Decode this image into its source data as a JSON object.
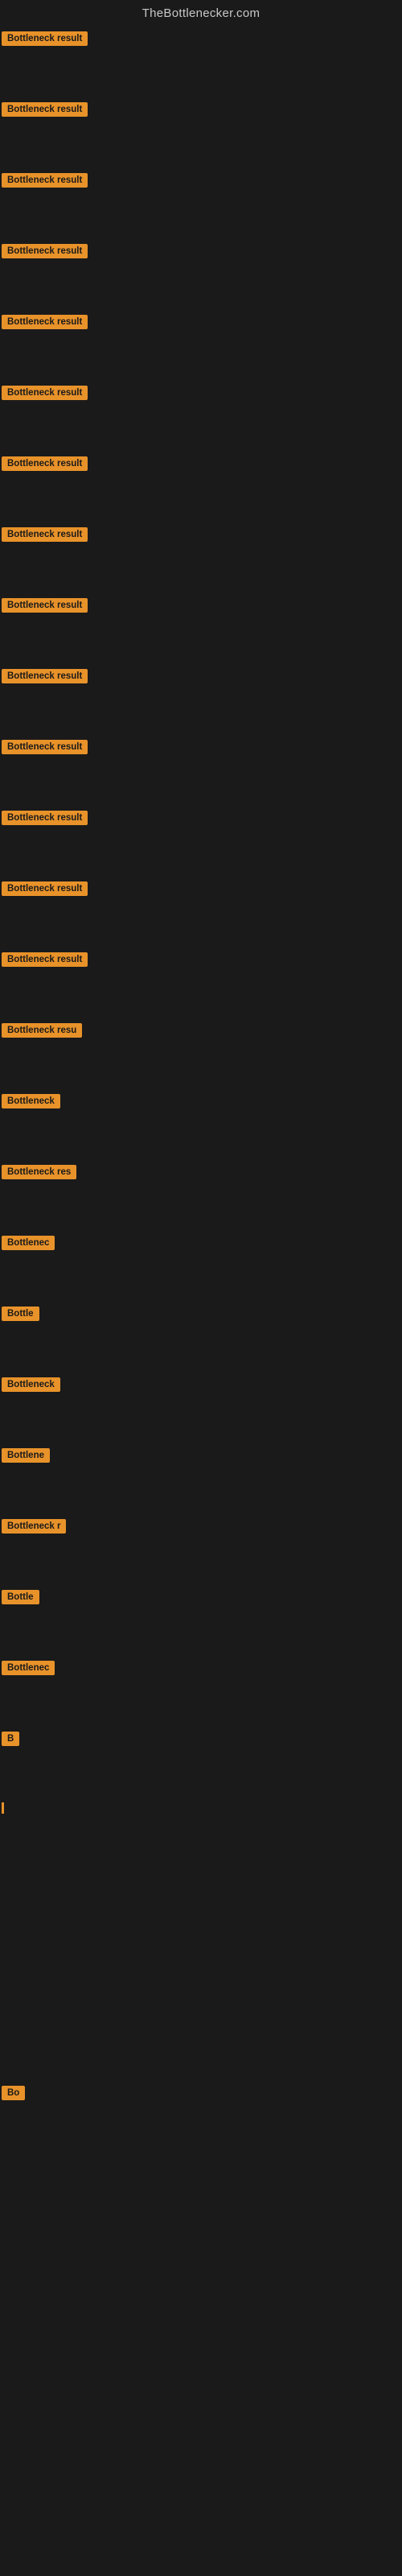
{
  "header": {
    "title": "TheBottlenecker.com"
  },
  "rows": [
    {
      "id": 1,
      "label": "Bottleneck result",
      "label_width": 120
    },
    {
      "id": 2,
      "label": "Bottleneck result",
      "label_width": 120
    },
    {
      "id": 3,
      "label": "Bottleneck result",
      "label_width": 120
    },
    {
      "id": 4,
      "label": "Bottleneck result",
      "label_width": 120
    },
    {
      "id": 5,
      "label": "Bottleneck result",
      "label_width": 120
    },
    {
      "id": 6,
      "label": "Bottleneck result",
      "label_width": 120
    },
    {
      "id": 7,
      "label": "Bottleneck result",
      "label_width": 120
    },
    {
      "id": 8,
      "label": "Bottleneck result",
      "label_width": 120
    },
    {
      "id": 9,
      "label": "Bottleneck result",
      "label_width": 120
    },
    {
      "id": 10,
      "label": "Bottleneck result",
      "label_width": 120
    },
    {
      "id": 11,
      "label": "Bottleneck result",
      "label_width": 120
    },
    {
      "id": 12,
      "label": "Bottleneck result",
      "label_width": 120
    },
    {
      "id": 13,
      "label": "Bottleneck result",
      "label_width": 120
    },
    {
      "id": 14,
      "label": "Bottleneck result",
      "label_width": 120
    },
    {
      "id": 15,
      "label": "Bottleneck resu",
      "label_width": 106
    },
    {
      "id": 16,
      "label": "Bottleneck",
      "label_width": 74
    },
    {
      "id": 17,
      "label": "Bottleneck res",
      "label_width": 98
    },
    {
      "id": 18,
      "label": "Bottlenec",
      "label_width": 68
    },
    {
      "id": 19,
      "label": "Bottle",
      "label_width": 50
    },
    {
      "id": 20,
      "label": "Bottleneck",
      "label_width": 68
    },
    {
      "id": 21,
      "label": "Bottlene",
      "label_width": 58
    },
    {
      "id": 22,
      "label": "Bottleneck r",
      "label_width": 78
    },
    {
      "id": 23,
      "label": "Bottle",
      "label_width": 46
    },
    {
      "id": 24,
      "label": "Bottlenec",
      "label_width": 64
    },
    {
      "id": 25,
      "label": "B",
      "label_width": 18
    },
    {
      "id": 26,
      "label": "",
      "label_width": 0
    },
    {
      "id": 27,
      "label": "",
      "label_width": 0
    },
    {
      "id": 28,
      "label": "",
      "label_width": 0
    },
    {
      "id": 29,
      "label": "",
      "label_width": 0
    },
    {
      "id": 30,
      "label": "Bo",
      "label_width": 22
    },
    {
      "id": 31,
      "label": "",
      "label_width": 0
    },
    {
      "id": 32,
      "label": "",
      "label_width": 0
    },
    {
      "id": 33,
      "label": "",
      "label_width": 0
    },
    {
      "id": 34,
      "label": "",
      "label_width": 0
    },
    {
      "id": 35,
      "label": "",
      "label_width": 0
    },
    {
      "id": 36,
      "label": "",
      "label_width": 0
    }
  ]
}
